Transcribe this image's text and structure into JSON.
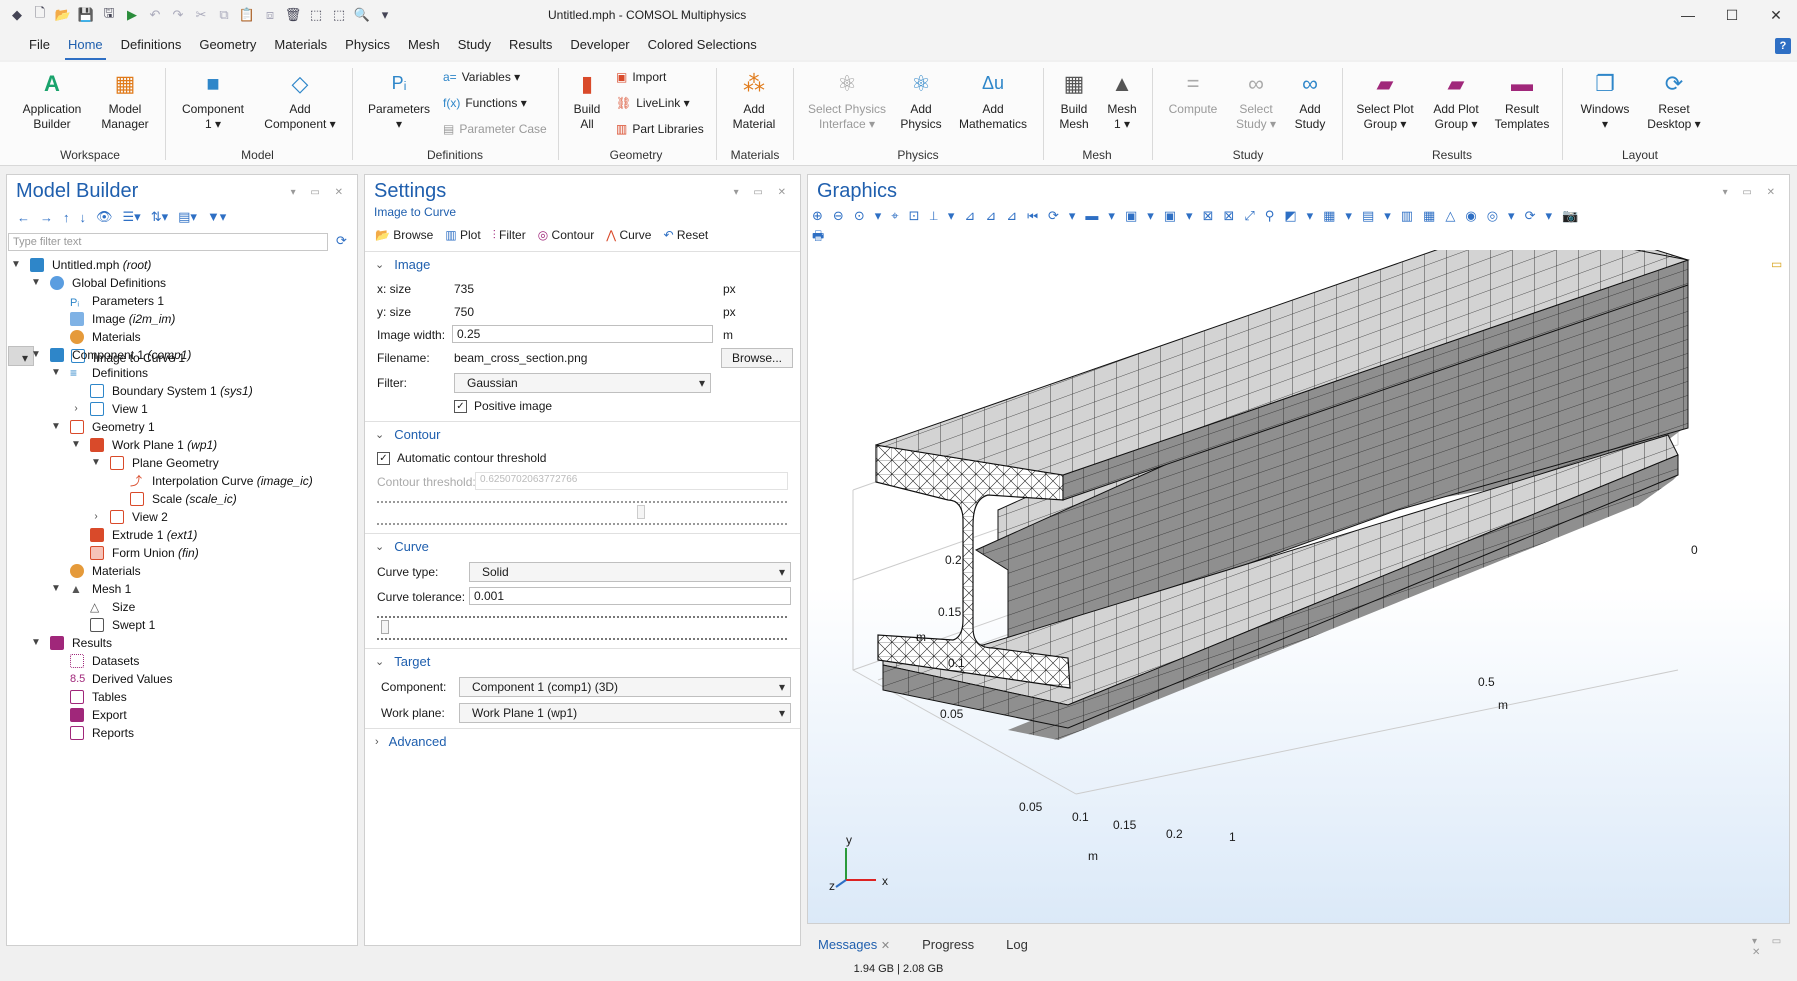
{
  "titlebar": {
    "title": "Untitled.mph - COMSOL Multiphysics"
  },
  "menu": {
    "tabs": [
      "File",
      "Home",
      "Definitions",
      "Geometry",
      "Materials",
      "Physics",
      "Mesh",
      "Study",
      "Results",
      "Developer",
      "Colored Selections"
    ],
    "active": "Home"
  },
  "ribbon": {
    "app_builder": "Application\nBuilder",
    "model_manager": "Model\nManager",
    "component": "Component\n1 ▾",
    "add_component": "Add\nComponent ▾",
    "parameters": "Parameters\n▾",
    "variables": "Variables ▾",
    "functions": "Functions ▾",
    "parameter_case": "Parameter Case",
    "build_all": "Build\nAll",
    "import": "Import",
    "livelink": "LiveLink ▾",
    "part_libraries": "Part Libraries",
    "add_material": "Add\nMaterial",
    "select_physics": "Select Physics\nInterface ▾",
    "add_physics": "Add\nPhysics",
    "add_math": "Add\nMathematics",
    "build_mesh": "Build\nMesh",
    "mesh1": "Mesh\n1 ▾",
    "compute": "Compute",
    "select_study": "Select\nStudy ▾",
    "add_study": "Add\nStudy",
    "select_plot_group": "Select Plot\nGroup ▾",
    "add_plot_group": "Add Plot\nGroup ▾",
    "result_templates": "Result\nTemplates",
    "windows": "Windows\n▾",
    "reset_desktop": "Reset\nDesktop ▾",
    "groups": {
      "workspace": "Workspace",
      "model": "Model",
      "definitions": "Definitions",
      "geometry": "Geometry",
      "materials": "Materials",
      "physics": "Physics",
      "mesh": "Mesh",
      "study": "Study",
      "results": "Results",
      "layout": "Layout"
    }
  },
  "model_builder": {
    "title": "Model Builder",
    "filter_placeholder": "Type filter text",
    "items": [
      {
        "label": "Untitled.mph",
        "suffix": "(root)"
      },
      {
        "label": "Global Definitions",
        "suffix": ""
      },
      {
        "label": "Parameters 1",
        "suffix": ""
      },
      {
        "label": "Image",
        "suffix": "(i2m_im)"
      },
      {
        "label": "Materials",
        "suffix": ""
      },
      {
        "label": "Image to Curve 1",
        "suffix": ""
      },
      {
        "label": "Component 1",
        "suffix": "(comp1)"
      },
      {
        "label": "Definitions",
        "suffix": ""
      },
      {
        "label": "Boundary System 1",
        "suffix": "(sys1)"
      },
      {
        "label": "View 1",
        "suffix": ""
      },
      {
        "label": "Geometry 1",
        "suffix": ""
      },
      {
        "label": "Work Plane 1",
        "suffix": "(wp1)"
      },
      {
        "label": "Plane Geometry",
        "suffix": ""
      },
      {
        "label": "Interpolation Curve",
        "suffix": "(image_ic)"
      },
      {
        "label": "Scale",
        "suffix": "(scale_ic)"
      },
      {
        "label": "View 2",
        "suffix": ""
      },
      {
        "label": "Extrude 1",
        "suffix": "(ext1)"
      },
      {
        "label": "Form Union",
        "suffix": "(fin)"
      },
      {
        "label": "Materials",
        "suffix": ""
      },
      {
        "label": "Mesh 1",
        "suffix": ""
      },
      {
        "label": "Size",
        "suffix": ""
      },
      {
        "label": "Swept 1",
        "suffix": ""
      },
      {
        "label": "Results",
        "suffix": ""
      },
      {
        "label": "Datasets",
        "suffix": ""
      },
      {
        "label": "Derived Values",
        "suffix": ""
      },
      {
        "label": "Tables",
        "suffix": ""
      },
      {
        "label": "Export",
        "suffix": ""
      },
      {
        "label": "Reports",
        "suffix": ""
      }
    ]
  },
  "settings": {
    "title": "Settings",
    "subtitle": "Image to Curve",
    "toolbar": {
      "browse": "Browse",
      "plot": "Plot",
      "filter": "Filter",
      "contour": "Contour",
      "curve": "Curve",
      "reset": "Reset"
    },
    "image": {
      "section": "Image",
      "xsize_label": "x: size",
      "xsize": "735",
      "ysize_label": "y: size",
      "ysize": "750",
      "px": "px",
      "width_label": "Image width:",
      "width": "0.25",
      "m": "m",
      "filename_label": "Filename:",
      "filename": "beam_cross_section.png",
      "browse": "Browse...",
      "filter_label": "Filter:",
      "filter": "Gaussian",
      "positive": "Positive image"
    },
    "contour": {
      "section": "Contour",
      "auto": "Automatic contour threshold",
      "threshold_label": "Contour threshold:",
      "threshold": "0.6250702063772766"
    },
    "curve": {
      "section": "Curve",
      "type_label": "Curve type:",
      "type": "Solid",
      "tol_label": "Curve tolerance:",
      "tol": "0.001"
    },
    "target": {
      "section": "Target",
      "component_label": "Component:",
      "component": "Component 1 (comp1) (3D)",
      "workplane_label": "Work plane:",
      "workplane": "Work Plane 1 (wp1)"
    },
    "advanced": "Advanced"
  },
  "graphics": {
    "title": "Graphics",
    "axis": {
      "y_ticks": [
        "0.2",
        "0.15",
        "0.1",
        "0.05"
      ],
      "y_unit": "m",
      "x_ticks": [
        "0.05",
        "0.1",
        "0.15",
        "0.2"
      ],
      "x_unit": "m",
      "z_ticks": [
        "0.5",
        "1",
        "0"
      ],
      "z_unit": "m",
      "triad_x": "x",
      "triad_y": "y",
      "triad_z": "z"
    }
  },
  "bottom": {
    "messages": "Messages",
    "progress": "Progress",
    "log": "Log"
  },
  "status": {
    "memory": "1.94 GB | 2.08 GB"
  }
}
